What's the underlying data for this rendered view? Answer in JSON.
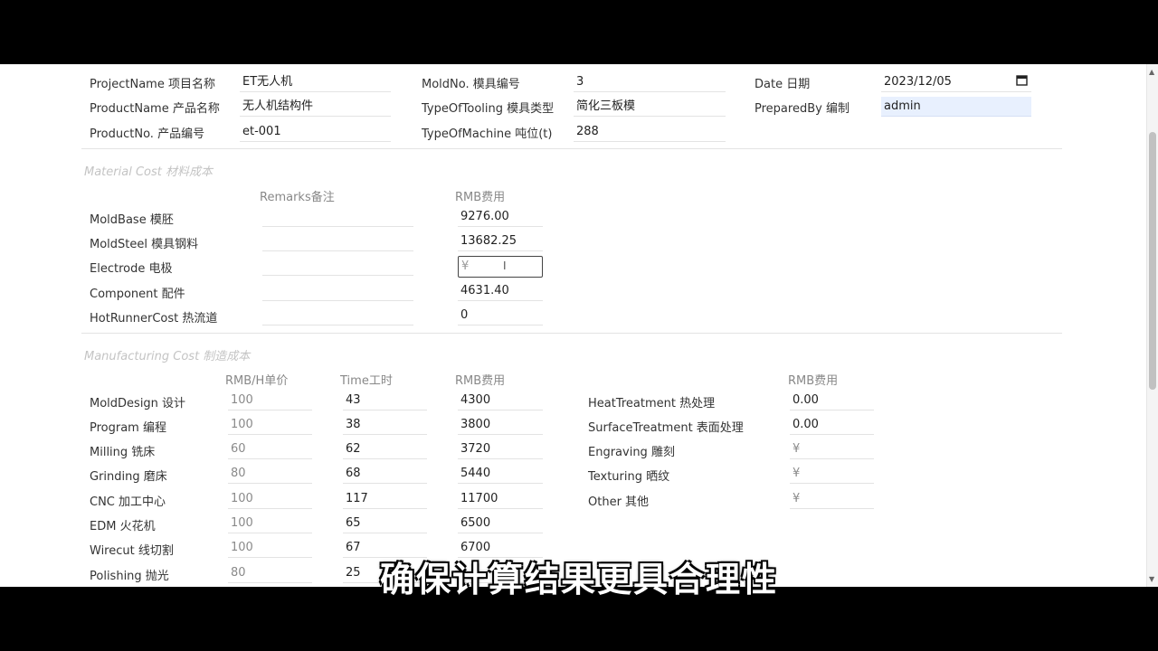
{
  "header": {
    "project_name_label": "ProjectName 项目名称",
    "project_name": "ET无人机",
    "product_name_label": "ProductName 产品名称",
    "product_name": "无人机结构件",
    "product_no_label": "ProductNo. 产品编号",
    "product_no": "et-001",
    "mold_no_label": "MoldNo. 模具编号",
    "mold_no": "3",
    "tooling_type_label": "TypeOfTooling 模具类型",
    "tooling_type": "简化三板模",
    "machine_type_label": "TypeOfMachine 吨位(t)",
    "machine_type": "288",
    "date_label": "Date 日期",
    "date": "2023/12/05",
    "prepared_by_label": "PreparedBy 编制",
    "prepared_by": "admin"
  },
  "material": {
    "section_title": "Material Cost 材料成本",
    "col_remarks": "Remarks备注",
    "col_rmb": "RMB费用",
    "rows": [
      {
        "label": "MoldBase 模胚",
        "remarks": "",
        "rmb": "9276.00"
      },
      {
        "label": "MoldSteel 模具钢料",
        "remarks": "",
        "rmb": "13682.25"
      },
      {
        "label": "Electrode 电极",
        "remarks": "",
        "rmb": "¥"
      },
      {
        "label": "Component 配件",
        "remarks": "",
        "rmb": "4631.40"
      },
      {
        "label": "HotRunnerCost 热流道",
        "remarks": "",
        "rmb": "0"
      }
    ]
  },
  "manufacturing": {
    "section_title": "Manufacturing Cost 制造成本",
    "col_rate": "RMB/H单价",
    "col_time": "Time工时",
    "col_rmb": "RMB费用",
    "col_rmb2": "RMB费用",
    "rows": [
      {
        "label": "MoldDesign 设计",
        "rate": "100",
        "time": "43",
        "rmb": "4300"
      },
      {
        "label": "Program 编程",
        "rate": "100",
        "time": "38",
        "rmb": "3800"
      },
      {
        "label": "Milling 铣床",
        "rate": "60",
        "time": "62",
        "rmb": "3720"
      },
      {
        "label": "Grinding 磨床",
        "rate": "80",
        "time": "68",
        "rmb": "5440"
      },
      {
        "label": "CNC 加工中心",
        "rate": "100",
        "time": "117",
        "rmb": "11700"
      },
      {
        "label": "EDM 火花机",
        "rate": "100",
        "time": "65",
        "rmb": "6500"
      },
      {
        "label": "Wirecut 线切割",
        "rate": "100",
        "time": "67",
        "rmb": "6700"
      },
      {
        "label": "Polishing 抛光",
        "rate": "80",
        "time": "25",
        "rmb": ""
      }
    ],
    "other_rows": [
      {
        "label": "HeatTreatment 热处理",
        "rmb": "0.00"
      },
      {
        "label": "SurfaceTreatment 表面处理",
        "rmb": "0.00"
      },
      {
        "label": "Engraving 雕刻",
        "rmb": "¥"
      },
      {
        "label": "Texturing 晒纹",
        "rmb": "¥"
      },
      {
        "label": "Other 其他",
        "rmb": "¥"
      }
    ]
  },
  "subtitle": "确保计算结果更具合理性"
}
